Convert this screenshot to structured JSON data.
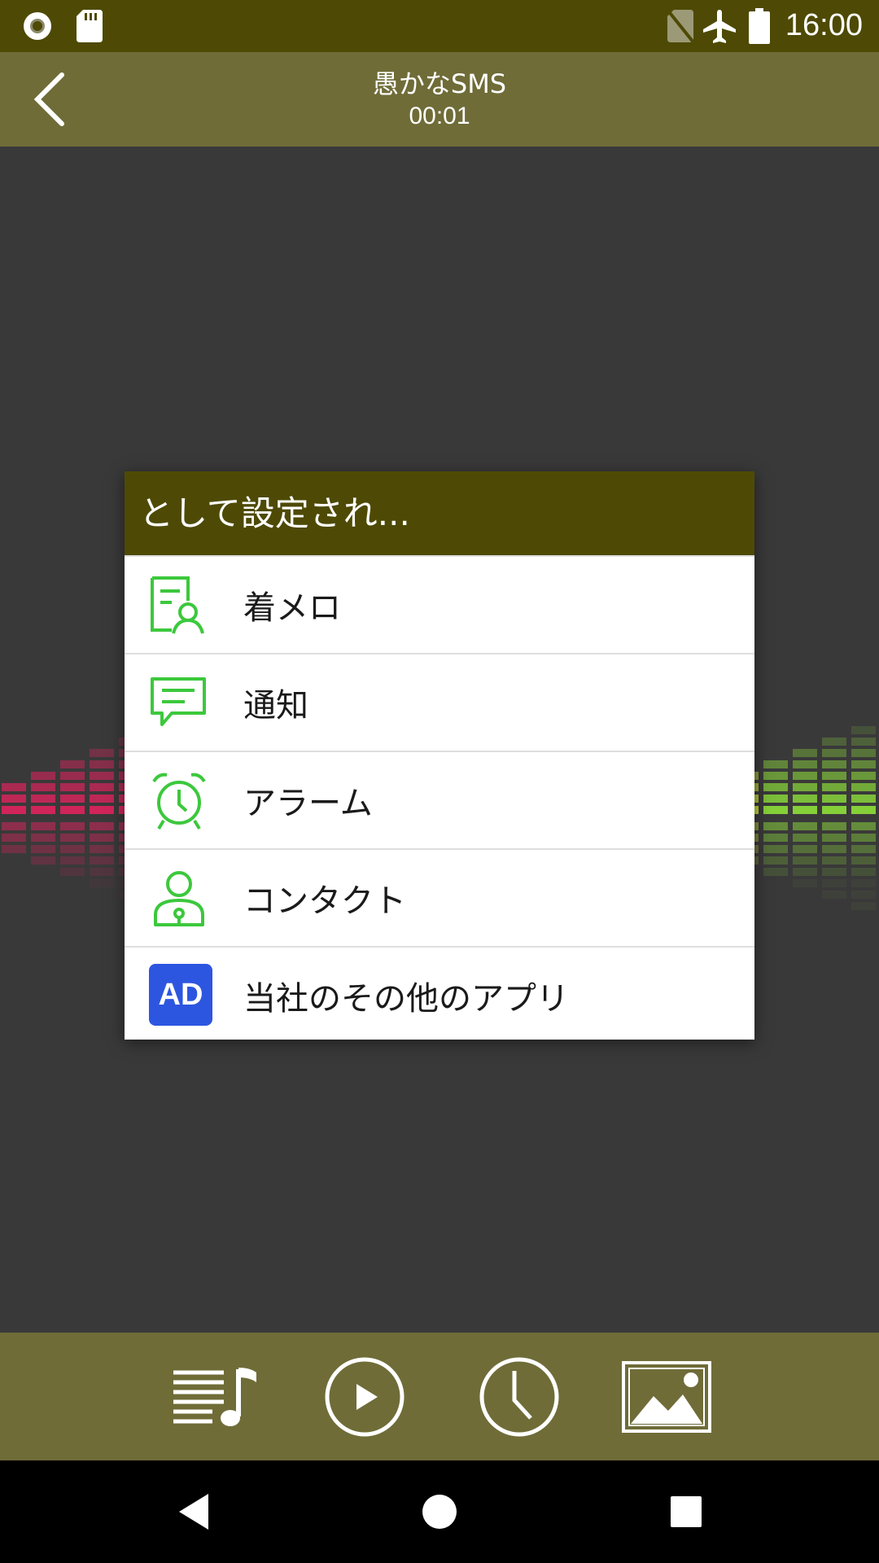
{
  "status_bar": {
    "time": "16:00"
  },
  "app_bar": {
    "title": "愚かなSMS",
    "elapsed": "00:01"
  },
  "dialog": {
    "title": "として設定され...",
    "options": [
      {
        "label": "着メロ",
        "icon": "ringtone-icon"
      },
      {
        "label": "通知",
        "icon": "notification-icon"
      },
      {
        "label": "アラーム",
        "icon": "alarm-clock-icon"
      },
      {
        "label": "コンタクト",
        "icon": "contact-icon"
      },
      {
        "label": "当社のその他のアプリ",
        "icon": "ad-icon",
        "badge": "AD"
      }
    ]
  },
  "bottom_bar": {
    "buttons": [
      "playlist-icon",
      "play-icon",
      "clock-icon",
      "image-icon"
    ]
  },
  "colors": {
    "status_bar": "#4e4a05",
    "app_bar": "#6f6c38",
    "accent_green": "#3cc83c",
    "ad_blue": "#2d56e0"
  }
}
